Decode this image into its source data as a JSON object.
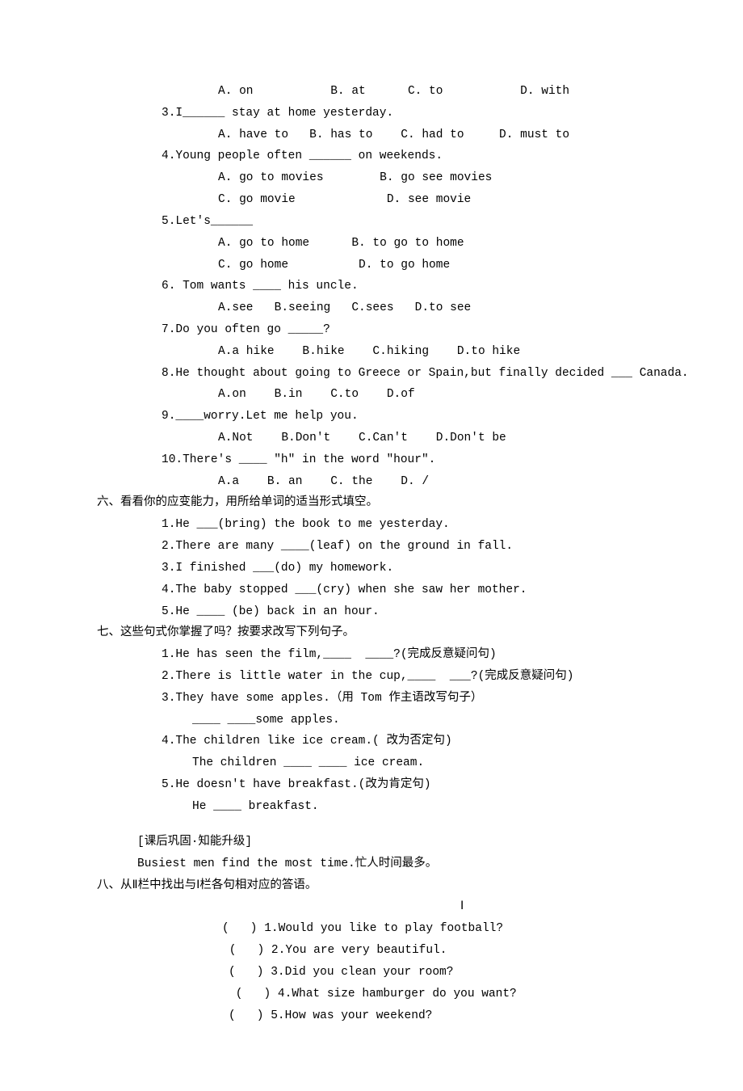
{
  "q2_opt": "A. on           B. at      C. to           D. with",
  "q3": "3.I______ stay at home yesterday.",
  "q3_opt": "A. have to   B. has to    C. had to     D. must to",
  "q4": "4.Young people often ______ on weekends.",
  "q4_optA": "A. go to movies        B. go see movies",
  "q4_optB": "C. go movie             D. see movie",
  "q5": "5.Let's______",
  "q5_optA": "A. go to home      B. to go to home",
  "q5_optB": "C. go home          D. to go home",
  "q6": "6. Tom wants ____ his uncle.",
  "q6_opt": "A.see   B.seeing   C.sees   D.to see",
  "q7": "7.Do you often go _____?",
  "q7_opt": "A.a hike    B.hike    C.hiking    D.to hike",
  "q8": "8.He thought about going to Greece or Spain,but finally decided ___ Canada.",
  "q8_opt": "A.on    B.in    C.to    D.of",
  "q9": "9.____worry.Let me help you.",
  "q9_opt": "A.Not    B.Don't    C.Can't    D.Don't be",
  "q10": "10.There's ____ \"h\" in the word \"hour\".",
  "q10_opt": "A.a    B. an    C. the    D. /",
  "h6": "六、看看你的应变能力，用所给单词的适当形式填空。",
  "s6_1": "1.He ___(bring) the book to me yesterday.",
  "s6_2": "2.There are many ____(leaf) on the ground in fall.",
  "s6_3": "3.I finished ___(do) my homework.",
  "s6_4": "4.The baby stopped ___(cry) when she saw her mother.",
  "s6_5": "5.He ____ (be) back in an hour.",
  "h7": "七、这些句式你掌握了吗？按要求改写下列句子。",
  "s7_1": "1.He has seen the film,____  ____?(完成反意疑问句)",
  "s7_2": "2.There is little water in the cup,____  ___?(完成反意疑问句)",
  "s7_3": "3.They have some apples.（用 Tom 作主语改写句子）",
  "s7_3b": "____ ____some apples.",
  "s7_4": "4.The children like ice cream.( 改为否定句)",
  "s7_4b": "The children ____ ____ ice cream.",
  "s7_5": "5.He doesn't have breakfast.(改为肯定句)",
  "s7_5b": "He ____ breakfast.",
  "post1": "[课后巩固·知能升级]",
  "post2": "Busiest men find the most time.忙人时间最多。",
  "h8": "八、从Ⅱ栏中找出与Ⅰ栏各句相对应的答语。",
  "col_I": "Ⅰ",
  "m1": "(   ) 1.Would you like to play football?",
  "m2": " (   ) 2.You are very beautiful.",
  "m3": "(   ) 3.Did you clean your room?",
  "m4": " (   ) 4.What size hamburger do you want?",
  "m5": "(   ) 5.How was your weekend?"
}
